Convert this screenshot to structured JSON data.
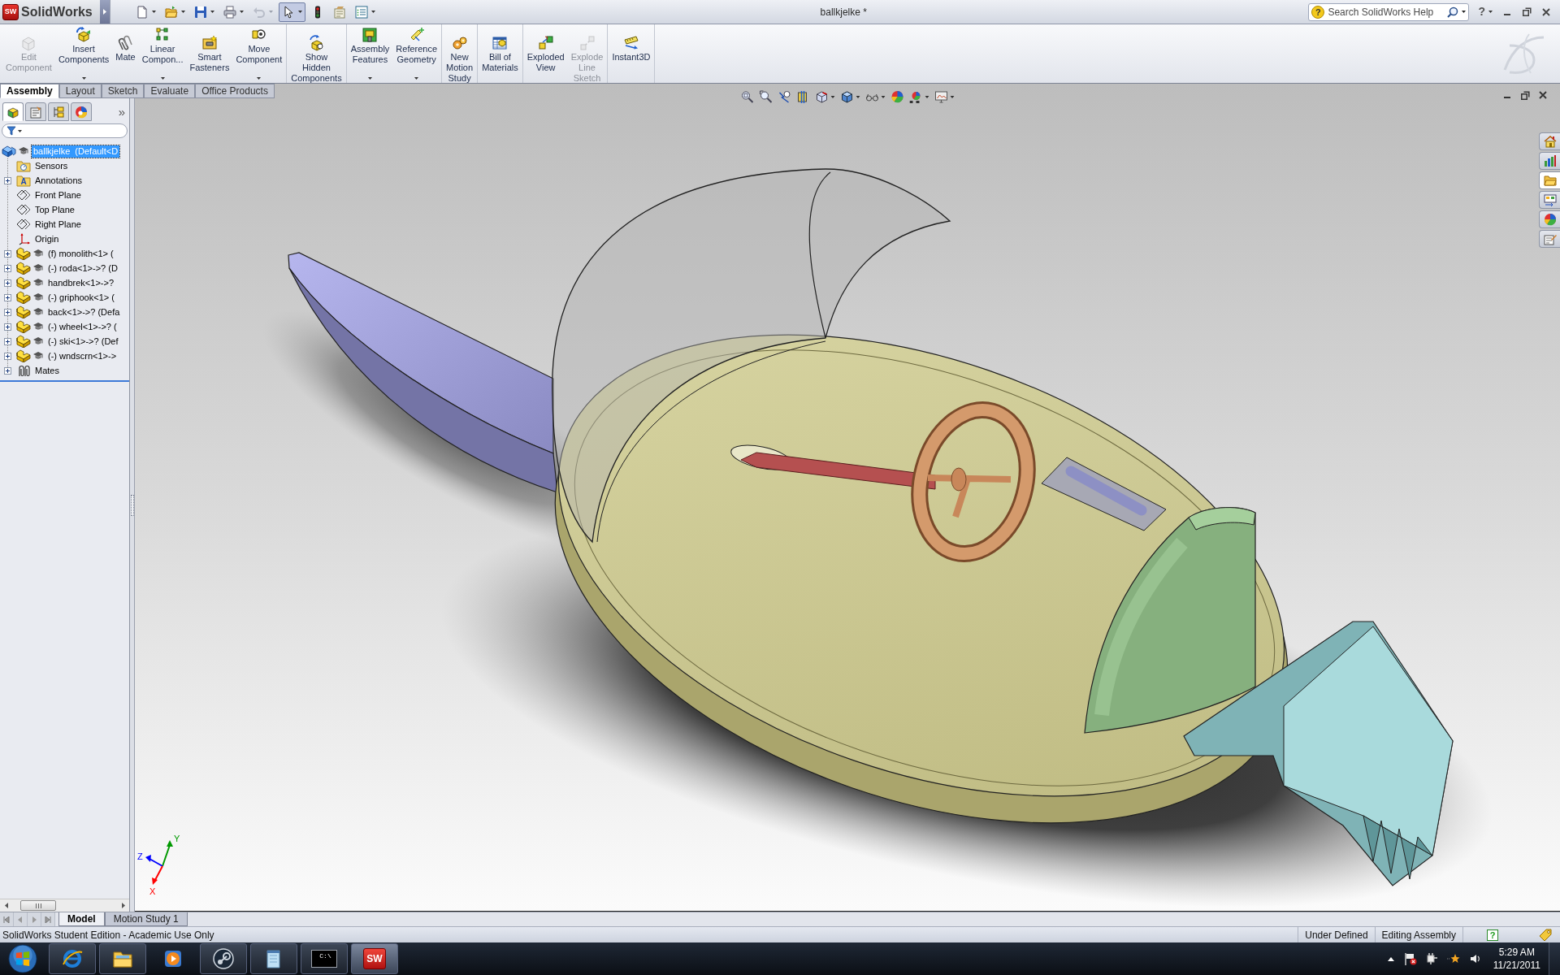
{
  "app": {
    "logo_letters": "SW",
    "name": "SolidWorks"
  },
  "quick_access_toolbar": [
    {
      "dropdown": true,
      "pressed": false,
      "disabled": false
    },
    {
      "dropdown": true,
      "pressed": false,
      "disabled": false
    },
    {
      "dropdown": true,
      "pressed": false,
      "disabled": false
    },
    {
      "dropdown": true,
      "pressed": false,
      "disabled": false
    },
    {
      "dropdown": true,
      "pressed": false,
      "disabled": true
    },
    {
      "dropdown": true,
      "pressed": true,
      "disabled": false
    },
    {
      "dropdown": false,
      "pressed": false,
      "disabled": false
    },
    {
      "dropdown": false,
      "pressed": false,
      "disabled": false
    },
    {
      "dropdown": true,
      "pressed": false,
      "disabled": false
    }
  ],
  "window": {
    "title": "ballkjelke *"
  },
  "search": {
    "help_glyph": "?",
    "placeholder": "Search SolidWorks Help"
  },
  "help_menu": {
    "glyph": "?"
  },
  "command_manager": {
    "groups": [
      [
        {
          "lines": [
            "Edit",
            "Component"
          ],
          "disabled": true,
          "dropdown": false
        },
        {
          "lines": [
            "Insert",
            "Components"
          ],
          "disabled": false,
          "dropdown": true
        },
        {
          "lines": [
            "Mate"
          ],
          "disabled": false,
          "dropdown": false
        },
        {
          "lines": [
            "Linear",
            "Compon..."
          ],
          "disabled": false,
          "dropdown": true
        },
        {
          "lines": [
            "Smart",
            "Fasteners"
          ],
          "disabled": false,
          "dropdown": false
        },
        {
          "lines": [
            "Move",
            "Component"
          ],
          "disabled": false,
          "dropdown": true
        }
      ],
      [
        {
          "lines": [
            "Show",
            "Hidden",
            "Components"
          ],
          "disabled": false,
          "dropdown": false
        }
      ],
      [
        {
          "lines": [
            "Assembly",
            "Features"
          ],
          "disabled": false,
          "dropdown": true
        },
        {
          "lines": [
            "Reference",
            "Geometry"
          ],
          "disabled": false,
          "dropdown": true
        }
      ],
      [
        {
          "lines": [
            "New",
            "Motion",
            "Study"
          ],
          "disabled": false,
          "dropdown": false
        }
      ],
      [
        {
          "lines": [
            "Bill of",
            "Materials"
          ],
          "disabled": false,
          "dropdown": false
        }
      ],
      [
        {
          "lines": [
            "Exploded",
            "View"
          ],
          "disabled": false,
          "dropdown": false
        },
        {
          "lines": [
            "Explode",
            "Line",
            "Sketch"
          ],
          "disabled": true,
          "dropdown": false
        }
      ],
      [
        {
          "lines": [
            "Instant3D"
          ],
          "disabled": false,
          "dropdown": false
        }
      ]
    ]
  },
  "command_tabs": [
    {
      "label": "Assembly",
      "selected": true
    },
    {
      "label": "Layout",
      "selected": false
    },
    {
      "label": "Sketch",
      "selected": false
    },
    {
      "label": "Evaluate",
      "selected": false
    },
    {
      "label": "Office Products",
      "selected": false
    }
  ],
  "feature_manager": {
    "tabs": [
      {
        "selected": true
      },
      {
        "selected": false
      },
      {
        "selected": false
      },
      {
        "selected": false
      }
    ],
    "overflow": "»",
    "tree": {
      "label": "ballkjelke  (Default<D",
      "kind": "assembly",
      "selected": true,
      "children": [
        {
          "label": "Sensors",
          "kind": "sensors",
          "selected": false
        },
        {
          "label": "Annotations",
          "kind": "annotations",
          "icon_glyph": "A",
          "selected": false,
          "expanded": false
        },
        {
          "label": "Front Plane",
          "kind": "plane",
          "selected": false
        },
        {
          "label": "Top Plane",
          "kind": "plane",
          "selected": false
        },
        {
          "label": "Right Plane",
          "kind": "plane",
          "selected": false
        },
        {
          "label": "Origin",
          "kind": "origin",
          "selected": false
        },
        {
          "label": "(f) monolith<1> (",
          "kind": "part",
          "selected": false,
          "expanded": false
        },
        {
          "label": "(-) roda<1>->? (D",
          "kind": "part",
          "selected": false,
          "expanded": false
        },
        {
          "label": "handbrek<1>->?",
          "kind": "part",
          "selected": false,
          "expanded": false
        },
        {
          "label": "(-) griphook<1> (",
          "kind": "part",
          "selected": false,
          "expanded": false
        },
        {
          "label": "back<1>->? (Defa",
          "kind": "part",
          "selected": false,
          "expanded": false
        },
        {
          "label": "(-) wheel<1>->? (",
          "kind": "part",
          "selected": false,
          "expanded": false
        },
        {
          "label": "(-) ski<1>->? (Def",
          "kind": "part",
          "selected": false,
          "expanded": false
        },
        {
          "label": "(-) wndscrn<1>->",
          "kind": "part",
          "selected": false,
          "expanded": false
        },
        {
          "label": "Mates",
          "kind": "mates",
          "selected": false,
          "expanded": false
        }
      ]
    }
  },
  "view_toolbar": [
    {
      "dropdown": false
    },
    {
      "dropdown": false
    },
    {
      "dropdown": false
    },
    {
      "dropdown": false
    },
    {
      "dropdown": true
    },
    {
      "dropdown": true
    },
    {
      "dropdown": true
    },
    {
      "dropdown": false
    },
    {
      "dropdown": true
    },
    {
      "dropdown": true
    }
  ],
  "graphics": {
    "triad": [
      {
        "label": "Y",
        "color": "#009900"
      },
      {
        "label": "Z",
        "color": "#0000ff"
      },
      {
        "label": "X",
        "color": "#ff0000"
      }
    ]
  },
  "task_pane_tabs": [
    {
      "selected": false
    },
    {
      "selected": false
    },
    {
      "selected": true
    },
    {
      "selected": false
    },
    {
      "selected": false
    },
    {
      "selected": false
    }
  ],
  "model_tabs": [
    {
      "label": "Model",
      "selected": true
    },
    {
      "label": "Motion Study 1",
      "selected": false
    }
  ],
  "status_bar": {
    "message": "SolidWorks Student Edition - Academic Use Only",
    "fields": [
      "Under Defined",
      "Editing Assembly"
    ],
    "help_glyph": "?"
  },
  "taskbar": {
    "apps": [
      {
        "running": true,
        "selected": false
      },
      {
        "running": true,
        "selected": false
      },
      {
        "running": false,
        "selected": false
      },
      {
        "running": true,
        "selected": false
      },
      {
        "running": true,
        "selected": false
      },
      {
        "running": true,
        "selected": false,
        "icon_text": "C:\\"
      },
      {
        "running": true,
        "selected": true,
        "icon_text": "SW"
      }
    ],
    "time": "5:29 AM",
    "date": "11/21/2011"
  }
}
